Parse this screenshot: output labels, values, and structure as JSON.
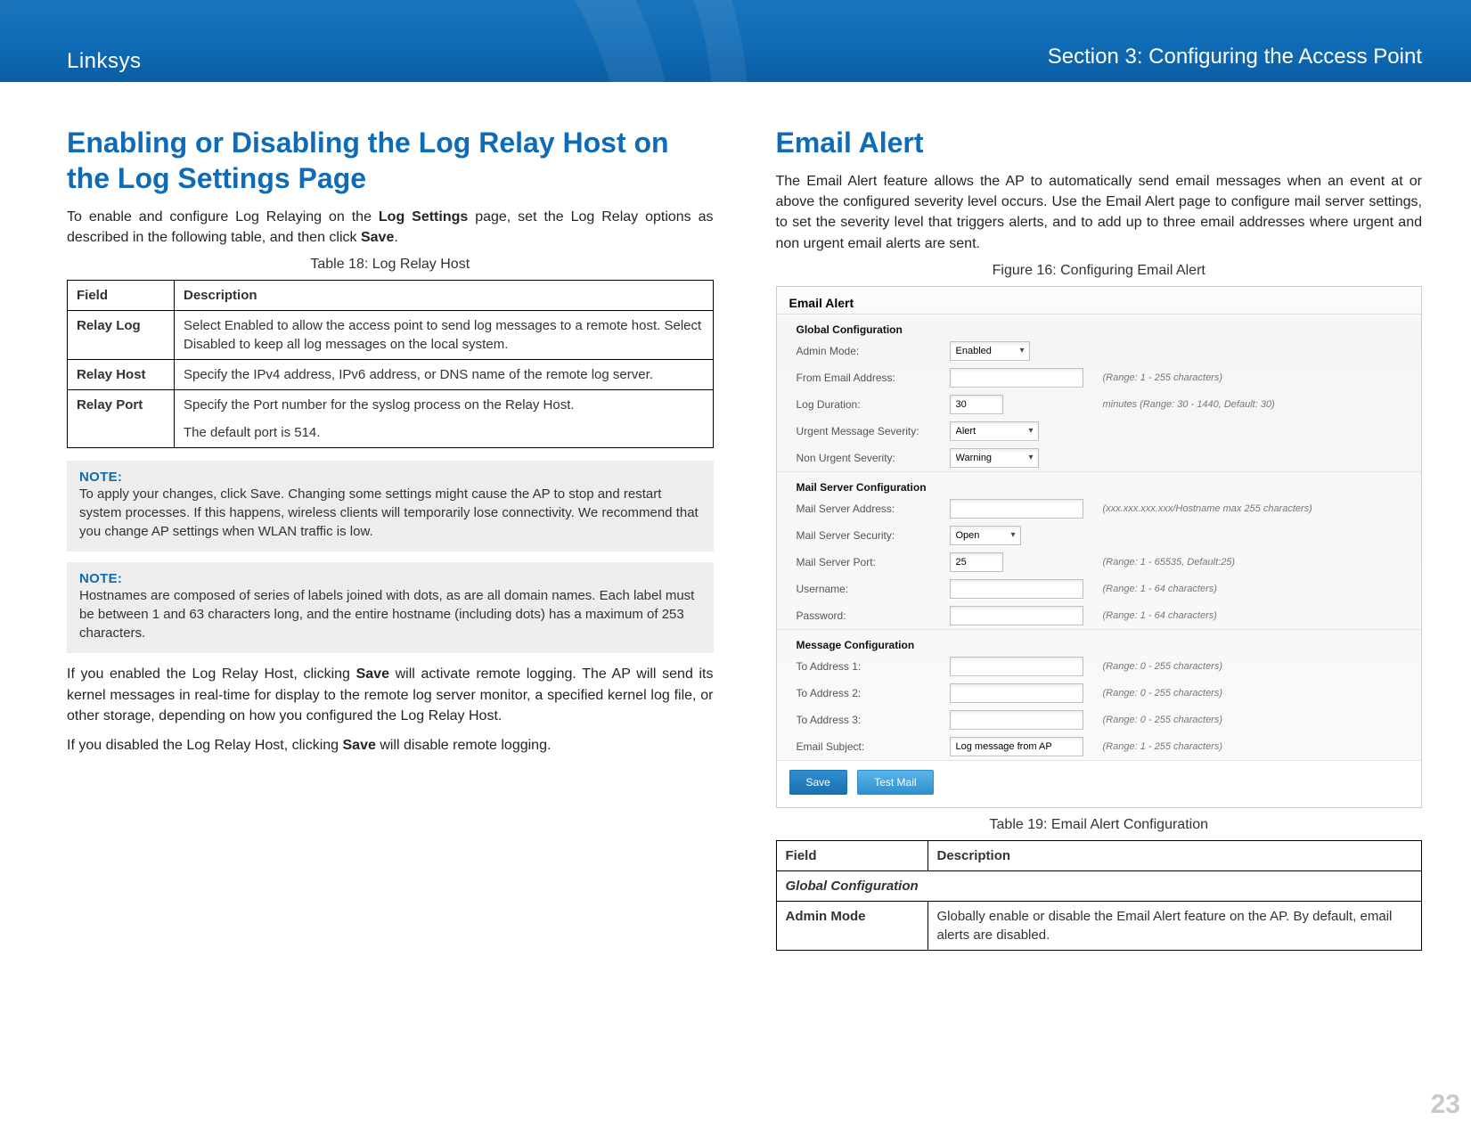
{
  "header": {
    "brand": "Linksys",
    "section": "Section 3:  Configuring the Access Point"
  },
  "page_number": "23",
  "left": {
    "title": "Enabling or Disabling the Log Relay Host on the Log Settings Page",
    "intro_a": "To enable and configure Log Relaying on the ",
    "intro_b_bold": "Log Settings",
    "intro_c": " page, set the Log Relay options as described in the following table, and then click ",
    "intro_d_bold": "Save",
    "intro_e": ".",
    "table_caption": "Table 18: Log Relay Host",
    "table": {
      "th_field": "Field",
      "th_desc": "Description",
      "rows": [
        {
          "field": "Relay Log",
          "desc": "Select Enabled to allow the access point to send log messages to a remote host. Select Disabled to keep all log messages on the local system."
        },
        {
          "field": "Relay Host",
          "desc": "Specify the IPv4 address, IPv6 address, or DNS name of the remote log server."
        },
        {
          "field": "Relay Port",
          "desc": "Specify the Port number for the syslog process on the Relay Host.",
          "desc2": "The default port is 514."
        }
      ]
    },
    "note1": {
      "label": "NOTE:",
      "body": "To apply your changes, click Save. Changing some settings might cause the AP to stop and restart system processes. If this happens, wireless clients will temporarily lose connectivity. We recommend that you change AP settings when WLAN traffic is low."
    },
    "note2": {
      "label": "NOTE:",
      "body": "Hostnames are composed of series of labels joined with dots, as are all domain names. Each label must be between 1 and 63 characters long, and the entire hostname (including dots) has a maximum of 253 characters."
    },
    "after1_a": "If you enabled the Log Relay Host, clicking ",
    "after1_b_bold": "Save",
    "after1_c": " will activate remote logging. The AP will send its kernel messages in real-time for display to the remote log server monitor, a specified kernel log file, or other storage, depending on how you configured the Log Relay Host.",
    "after2_a": "If you disabled the Log Relay Host, clicking ",
    "after2_b_bold": "Save",
    "after2_c": " will disable remote logging."
  },
  "right": {
    "title": "Email Alert",
    "intro": "The Email Alert feature allows the AP to automatically send email messages when an event at or above the configured severity level occurs. Use the Email Alert page to configure mail server settings, to set the severity level that triggers alerts, and to add up to three email addresses where urgent and non urgent email alerts are sent.",
    "figure_caption": "Figure 16: Configuring Email Alert",
    "figure": {
      "title": "Email Alert",
      "group_global": "Global Configuration",
      "admin_mode_label": "Admin Mode:",
      "admin_mode_value": "Enabled",
      "from_label": "From Email Address:",
      "from_hint": "(Range: 1 - 255 characters)",
      "logdur_label": "Log Duration:",
      "logdur_value": "30",
      "logdur_hint": "minutes (Range: 30 - 1440, Default: 30)",
      "urgent_label": "Urgent Message Severity:",
      "urgent_value": "Alert",
      "nonurgent_label": "Non Urgent Severity:",
      "nonurgent_value": "Warning",
      "group_mail": "Mail Server Configuration",
      "msa_label": "Mail Server Address:",
      "msa_hint": "(xxx.xxx.xxx.xxx/Hostname max 255 characters)",
      "msec_label": "Mail Server Security:",
      "msec_value": "Open",
      "mport_label": "Mail Server Port:",
      "mport_value": "25",
      "mport_hint": "(Range: 1 - 65535, Default:25)",
      "user_label": "Username:",
      "user_hint": "(Range: 1 - 64 characters)",
      "pass_label": "Password:",
      "pass_hint": "(Range: 1 - 64 characters)",
      "group_msg": "Message Configuration",
      "to1_label": "To Address 1:",
      "to1_hint": "(Range: 0 - 255 characters)",
      "to2_label": "To Address 2:",
      "to2_hint": "(Range: 0 - 255 characters)",
      "to3_label": "To Address 3:",
      "to3_hint": "(Range: 0 - 255 characters)",
      "subj_label": "Email Subject:",
      "subj_value": "Log message from AP",
      "subj_hint": "(Range: 1 - 255 characters)",
      "btn_save": "Save",
      "btn_test": "Test Mail"
    },
    "table_caption": "Table 19: Email Alert Configuration",
    "table": {
      "th_field": "Field",
      "th_desc": "Description",
      "section": "Global Configuration",
      "row_field": "Admin Mode",
      "row_desc": "Globally enable or disable the Email Alert feature on the AP. By default, email alerts are disabled."
    }
  }
}
